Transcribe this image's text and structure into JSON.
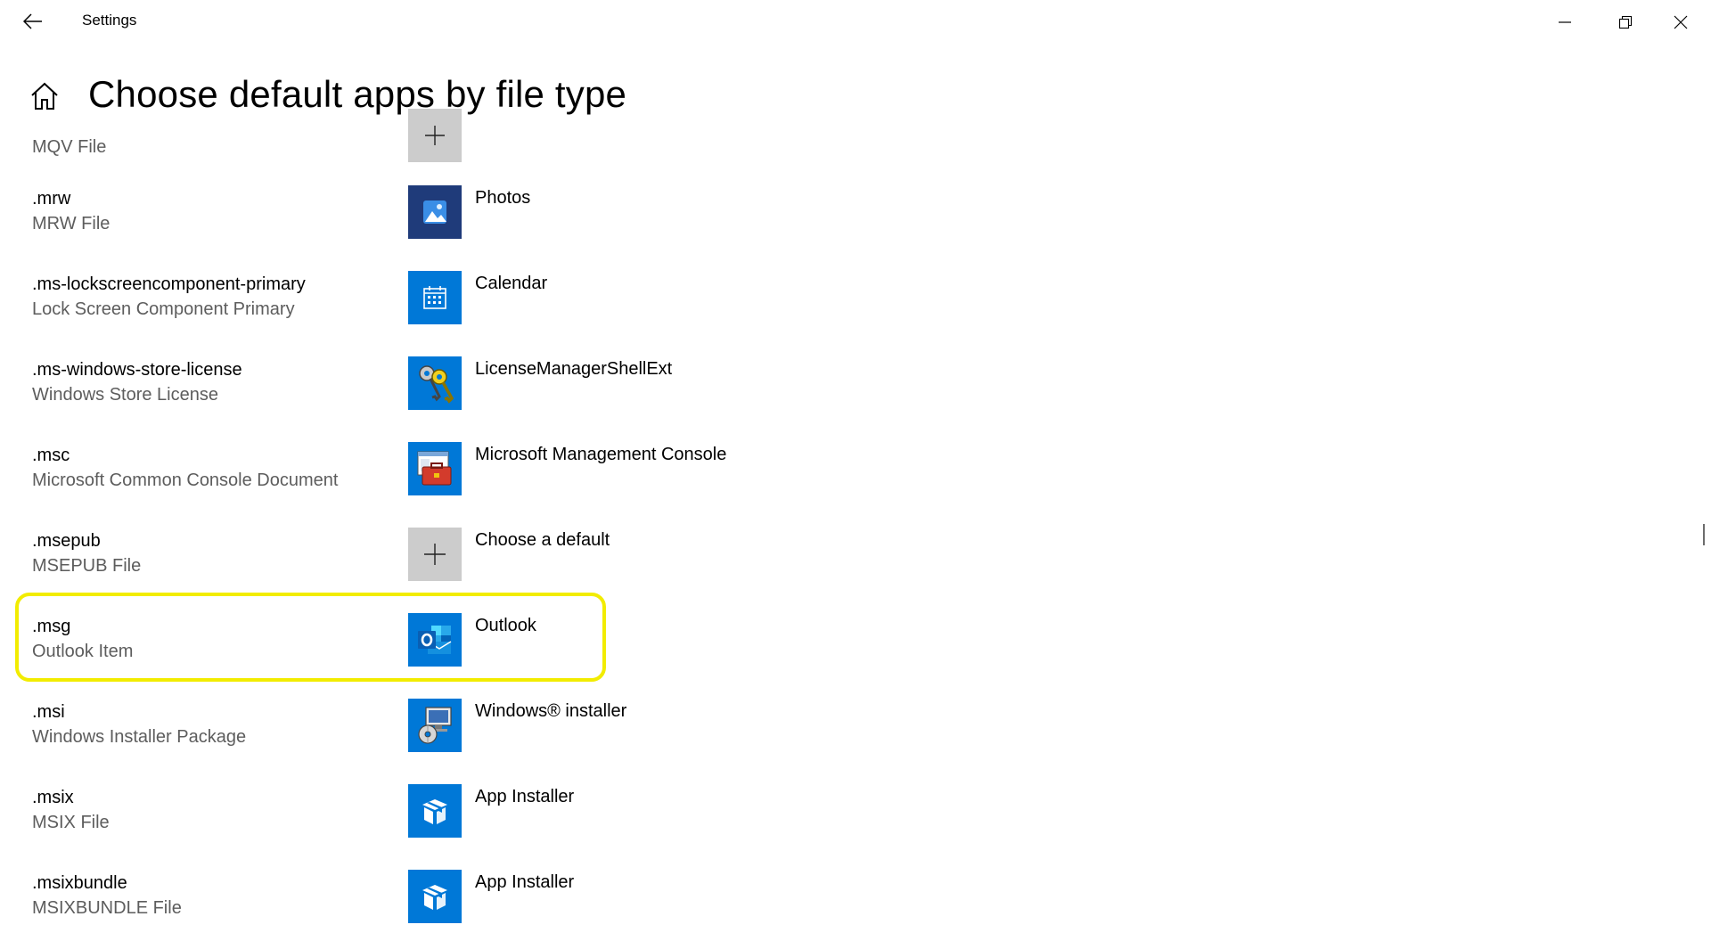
{
  "window": {
    "title": "Settings"
  },
  "header": {
    "page_title": "Choose default apps by file type"
  },
  "colors": {
    "highlight": "#f2ec00",
    "accent": "#0078d7",
    "photos_bg": "#1f3b7a",
    "choose_bg": "#cccccc"
  },
  "rows": [
    {
      "ext": "",
      "desc": "MQV File",
      "app": "",
      "icon": "plus-icon"
    },
    {
      "ext": ".mrw",
      "desc": "MRW File",
      "app": "Photos",
      "icon": "photos-icon"
    },
    {
      "ext": ".ms-lockscreencomponent-primary",
      "desc": "Lock Screen Component Primary",
      "app": "Calendar",
      "icon": "calendar-icon"
    },
    {
      "ext": ".ms-windows-store-license",
      "desc": "Windows Store License",
      "app": "LicenseManagerShellExt",
      "icon": "keys-icon"
    },
    {
      "ext": ".msc",
      "desc": "Microsoft Common Console Document",
      "app": "Microsoft Management Console",
      "icon": "toolbox-icon"
    },
    {
      "ext": ".msepub",
      "desc": "MSEPUB File",
      "app": "Choose a default",
      "icon": "plus-icon"
    },
    {
      "ext": ".msg",
      "desc": "Outlook Item",
      "app": "Outlook",
      "icon": "outlook-icon"
    },
    {
      "ext": ".msi",
      "desc": "Windows Installer Package",
      "app": "Windows® installer",
      "icon": "installer-icon"
    },
    {
      "ext": ".msix",
      "desc": "MSIX File",
      "app": "App Installer",
      "icon": "package-icon"
    },
    {
      "ext": ".msixbundle",
      "desc": "MSIXBUNDLE File",
      "app": "App Installer",
      "icon": "package-icon"
    }
  ]
}
